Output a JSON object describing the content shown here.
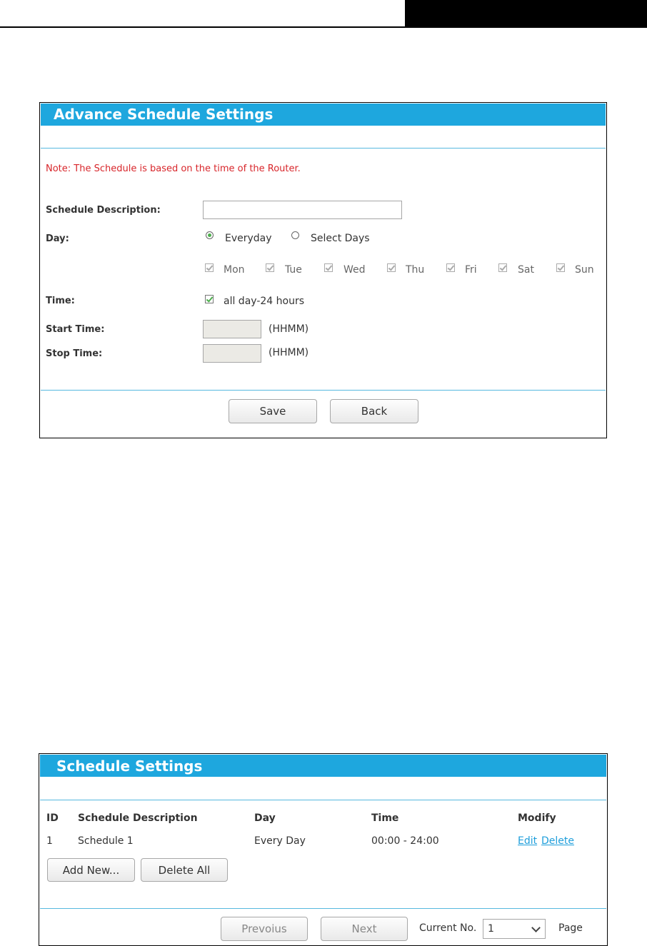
{
  "advance": {
    "title": "Advance Schedule Settings",
    "note": "Note: The Schedule is based on the time of the Router.",
    "description_label": "Schedule Description:",
    "description_value": "",
    "day_label": "Day:",
    "day_options": [
      "Everyday",
      "Select Days"
    ],
    "day_selected": "Everyday",
    "weekdays": [
      "Mon",
      "Tue",
      "Wed",
      "Thu",
      "Fri",
      "Sat",
      "Sun"
    ],
    "time_label": "Time:",
    "all_day_label": "all day-24 hours",
    "start_label": "Start Time:",
    "stop_label": "Stop Time:",
    "time_format": "(HHMM)",
    "save_label": "Save",
    "back_label": "Back"
  },
  "schedules": {
    "title": "Schedule Settings",
    "columns": [
      "ID",
      "Schedule Description",
      "Day",
      "Time",
      "Modify"
    ],
    "rows": [
      {
        "id": "1",
        "description": "Schedule 1",
        "day": "Every Day",
        "time": "00:00 - 24:00",
        "edit": "Edit",
        "delete": "Delete"
      }
    ],
    "add_new_label": "Add New...",
    "delete_all_label": "Delete All",
    "previous_label": "Prevoius",
    "next_label": "Next",
    "current_no_label": "Current No.",
    "current_no_value": "1",
    "page_label": "Page"
  },
  "colors": {
    "header_blue": "#1ea7de",
    "note_red": "#d8262b",
    "link_blue": "#1e9edb"
  }
}
